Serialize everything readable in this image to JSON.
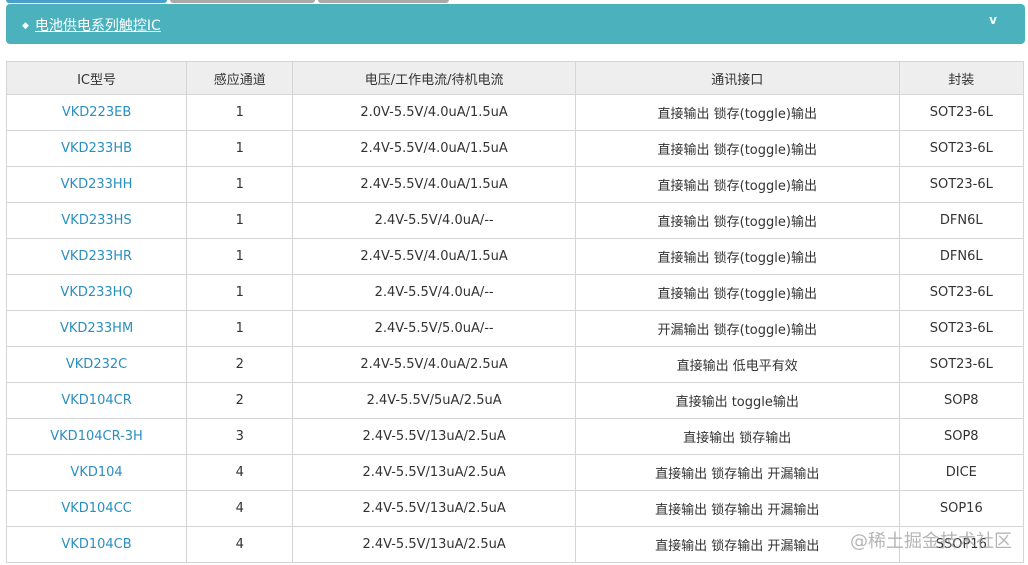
{
  "panel": {
    "title": "电池供电系列触控IC",
    "accent": "#4bb1bd"
  },
  "table": {
    "headers": [
      "IC型号",
      "感应通道",
      "电压/工作电流/待机电流",
      "通讯接口",
      "封装"
    ],
    "rows": [
      [
        "VKD223EB",
        "1",
        "2.0V-5.5V/4.0uA/1.5uA",
        "直接输出 锁存(toggle)输出",
        "SOT23-6L"
      ],
      [
        "VKD233HB",
        "1",
        "2.4V-5.5V/4.0uA/1.5uA",
        "直接输出 锁存(toggle)输出",
        "SOT23-6L"
      ],
      [
        "VKD233HH",
        "1",
        "2.4V-5.5V/4.0uA/1.5uA",
        "直接输出 锁存(toggle)输出",
        "SOT23-6L"
      ],
      [
        "VKD233HS",
        "1",
        "2.4V-5.5V/4.0uA/--",
        "直接输出 锁存(toggle)输出",
        "DFN6L"
      ],
      [
        "VKD233HR",
        "1",
        "2.4V-5.5V/4.0uA/1.5uA",
        "直接输出 锁存(toggle)输出",
        "DFN6L"
      ],
      [
        "VKD233HQ",
        "1",
        "2.4V-5.5V/4.0uA/--",
        "直接输出 锁存(toggle)输出",
        "SOT23-6L"
      ],
      [
        "VKD233HM",
        "1",
        "2.4V-5.5V/5.0uA/--",
        "开漏输出 锁存(toggle)输出",
        "SOT23-6L"
      ],
      [
        "VKD232C",
        "2",
        "2.4V-5.5V/4.0uA/2.5uA",
        "直接输出 低电平有效",
        "SOT23-6L"
      ],
      [
        "VKD104CR",
        "2",
        "2.4V-5.5V/5uA/2.5uA",
        "直接输出 toggle输出",
        "SOP8"
      ],
      [
        "VKD104CR-3H",
        "3",
        "2.4V-5.5V/13uA/2.5uA",
        "直接输出 锁存输出",
        "SOP8"
      ],
      [
        "VKD104",
        "4",
        "2.4V-5.5V/13uA/2.5uA",
        "直接输出 锁存输出 开漏输出",
        "DICE"
      ],
      [
        "VKD104CC",
        "4",
        "2.4V-5.5V/13uA/2.5uA",
        "直接输出 锁存输出 开漏输出",
        "SOP16"
      ],
      [
        "VKD104CB",
        "4",
        "2.4V-5.5V/13uA/2.5uA",
        "直接输出 锁存输出 开漏输出",
        "SSOP16"
      ]
    ]
  },
  "watermark": "@稀土掘金技术社区"
}
